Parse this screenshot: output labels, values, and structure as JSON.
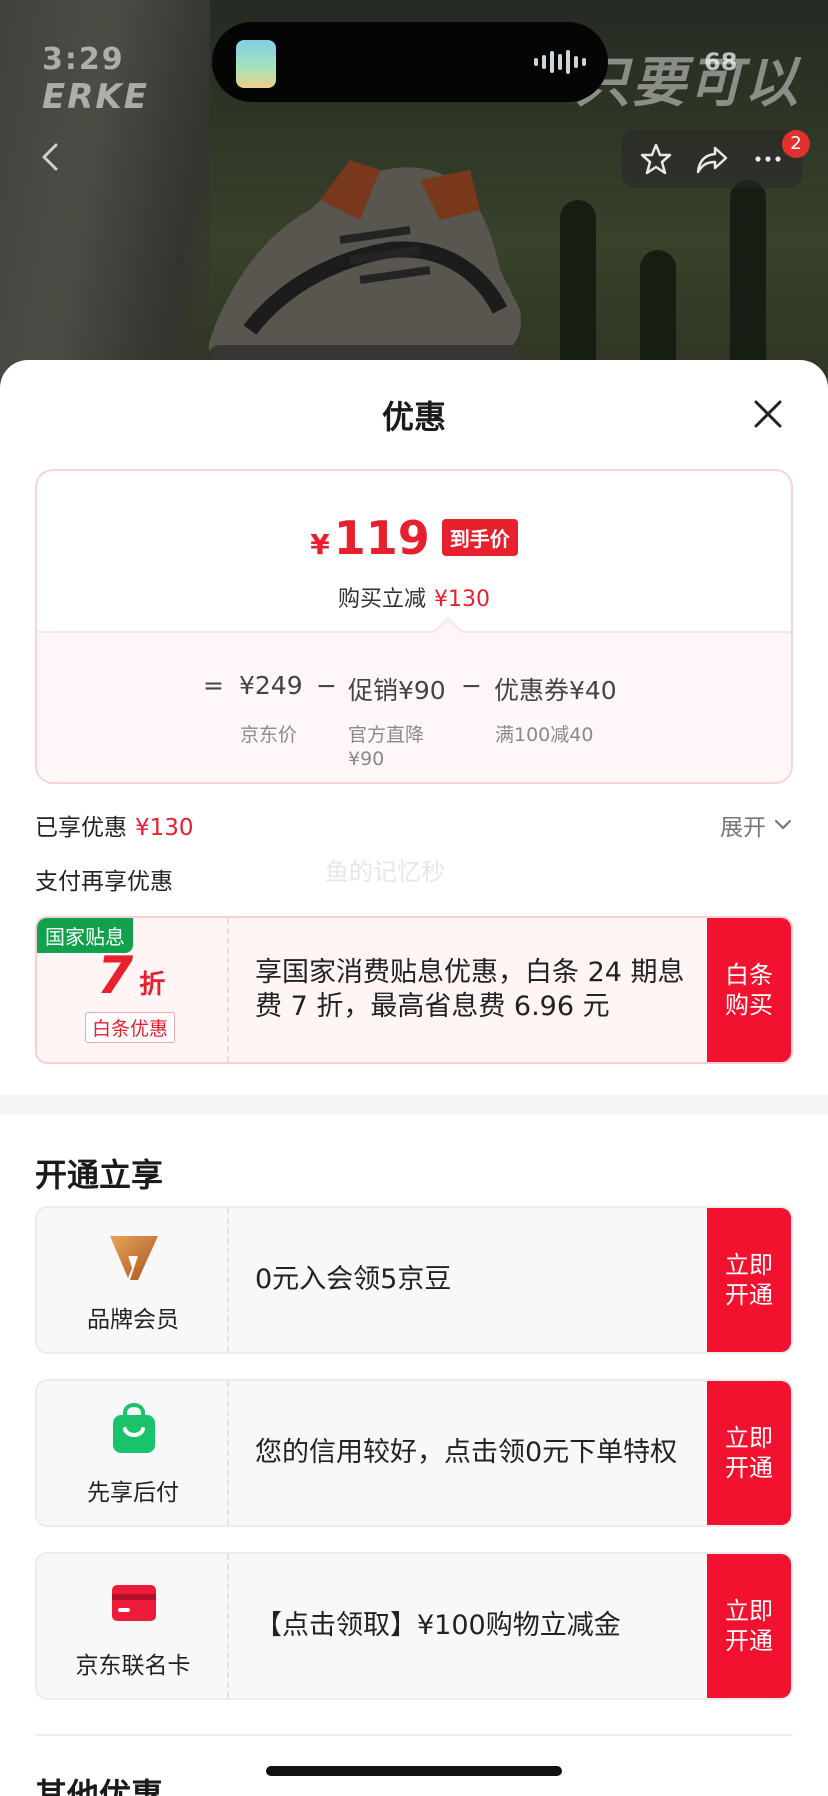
{
  "status_bar": {
    "time": "3:29",
    "battery": "68"
  },
  "background": {
    "brand_logo": "ERKE",
    "brand_slogan": "只要可以"
  },
  "top_actions": {
    "badge_count": "2"
  },
  "sheet": {
    "title": "优惠",
    "price_card": {
      "currency": "¥",
      "final_price": "119",
      "final_tag": "到手价",
      "reduce_label": "购买立减",
      "reduce_amount": "¥130",
      "eq_sign": "=",
      "base_price": "¥249",
      "minus1": "−",
      "promo_label": "促销¥90",
      "minus2": "−",
      "coupon_label": "优惠券¥40",
      "base_caption": "京东价",
      "promo_caption_1": "官方直降",
      "promo_caption_2": "¥90",
      "coupon_caption": "满100减40"
    },
    "enjoyed_label": "已享优惠",
    "enjoyed_amount": "¥130",
    "expand_label": "展开",
    "pay_more_label": "支付再享优惠",
    "watermark": "鱼的记忆秒",
    "subsidy": {
      "badge": "国家贴息",
      "discount_num": "7",
      "discount_unit": "折",
      "tag": "白条优惠",
      "description": "享国家消费贴息优惠，白条 24 期息费 7 折，最高省息费 6.96 元",
      "cta": "白条购买"
    },
    "open_section_title": "开通立享",
    "offers": [
      {
        "name": "品牌会员",
        "icon": "brand-v-logo-icon",
        "description": "0元入会领5京豆",
        "cta": "立即开通"
      },
      {
        "name": "先享后付",
        "icon": "shopping-bag-icon",
        "description": "您的信用较好，点击领0元下单特权",
        "cta": "立即开通"
      },
      {
        "name": "京东联名卡",
        "icon": "credit-card-icon",
        "description": "【点击领取】¥100购物立减金",
        "cta": "立即开通"
      }
    ],
    "other_section_title": "其他优惠"
  },
  "colors": {
    "accent": "#f2112f",
    "price_red": "#e8202e",
    "gov_green": "#11a04c"
  }
}
